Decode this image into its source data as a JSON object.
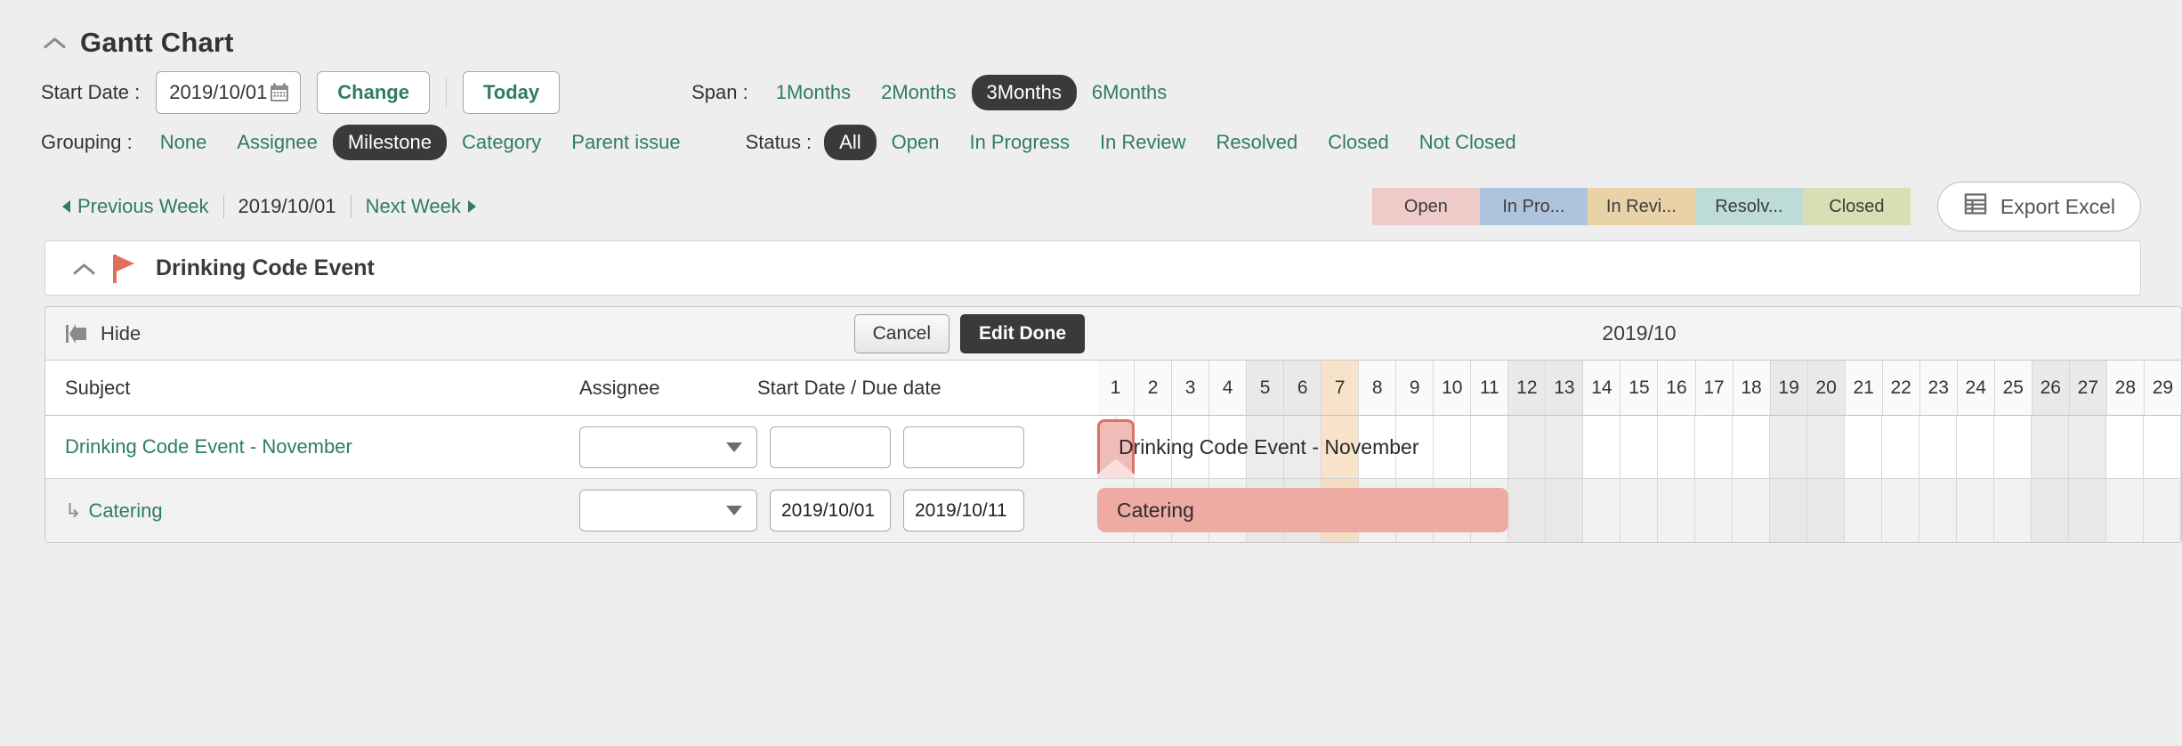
{
  "header": {
    "title": "Gantt Chart",
    "collapse_icon": "chevron-up-icon"
  },
  "controls": {
    "start_date_label": "Start Date :",
    "start_date_value": "2019/10/01",
    "calendar_icon": "calendar-icon",
    "change_label": "Change",
    "today_label": "Today",
    "grouping_label": "Grouping :",
    "grouping_options": [
      {
        "label": "None",
        "selected": false
      },
      {
        "label": "Assignee",
        "selected": false
      },
      {
        "label": "Milestone",
        "selected": true
      },
      {
        "label": "Category",
        "selected": false
      },
      {
        "label": "Parent issue",
        "selected": false
      }
    ],
    "span_label": "Span :",
    "span_options": [
      {
        "label": "1Months",
        "selected": false
      },
      {
        "label": "2Months",
        "selected": false
      },
      {
        "label": "3Months",
        "selected": true
      },
      {
        "label": "6Months",
        "selected": false
      }
    ],
    "status_label": "Status :",
    "status_options": [
      {
        "label": "All",
        "selected": true
      },
      {
        "label": "Open",
        "selected": false
      },
      {
        "label": "In Progress",
        "selected": false
      },
      {
        "label": "In Review",
        "selected": false
      },
      {
        "label": "Resolved",
        "selected": false
      },
      {
        "label": "Closed",
        "selected": false
      },
      {
        "label": "Not Closed",
        "selected": false
      }
    ]
  },
  "weeknav": {
    "previous_label": "Previous Week",
    "current_label": "2019/10/01",
    "next_label": "Next Week"
  },
  "legend": [
    {
      "label": "Open",
      "color": "#eecac9"
    },
    {
      "label": "In Pro...",
      "color": "#aec4dd"
    },
    {
      "label": "In Revi...",
      "color": "#e9d2a8"
    },
    {
      "label": "Resolv...",
      "color": "#bedcd6"
    },
    {
      "label": "Closed",
      "color": "#d9dfb2"
    }
  ],
  "export": {
    "label": "Export Excel",
    "icon": "spreadsheet-icon"
  },
  "milestone": {
    "title": "Drinking Code Event",
    "collapse_icon": "chevron-up-icon",
    "flag_icon": "flag-icon",
    "flag_color": "#e0705c"
  },
  "toolbar": {
    "hide_label": "Hide",
    "hide_icon": "collapse-left-icon",
    "cancel_label": "Cancel",
    "edit_done_label": "Edit Done"
  },
  "table": {
    "columns": [
      "Subject",
      "Assignee",
      "Start Date / Due date"
    ],
    "rows": [
      {
        "subject": "Drinking Code Event - November",
        "is_child": false,
        "assignee": "",
        "start_date": "",
        "due_date": "",
        "bar_type": "summary",
        "bar_start_day": 1,
        "bar_end_day": 1,
        "bar_label": "Drinking Code Event - November"
      },
      {
        "subject": "Catering",
        "is_child": true,
        "child_marker": "↳",
        "assignee": "",
        "start_date": "2019/10/01",
        "due_date": "2019/10/11",
        "bar_type": "task",
        "bar_start_day": 1,
        "bar_end_day": 11,
        "bar_label": "Catering"
      }
    ]
  },
  "calendar": {
    "month_label": "2019/10",
    "days": [
      1,
      2,
      3,
      4,
      5,
      6,
      7,
      8,
      9,
      10,
      11,
      12,
      13,
      14,
      15,
      16,
      17,
      18,
      19,
      20,
      21,
      22,
      23,
      24,
      25,
      26,
      27,
      28,
      29
    ],
    "weekend_days": [
      5,
      6,
      12,
      13,
      19,
      20,
      26,
      27
    ],
    "today_day": 7,
    "today_color": "#f7e3c9",
    "weekend_color": "#e9e9e9"
  },
  "colors": {
    "accent_green": "#2f7d5e",
    "selected_pill": "#3a3a3a",
    "page_bg": "#efeeee",
    "bar_summary_fill": "#efbdb8",
    "bar_summary_border": "#d9736a",
    "bar_task_fill": "#eeaba3"
  }
}
